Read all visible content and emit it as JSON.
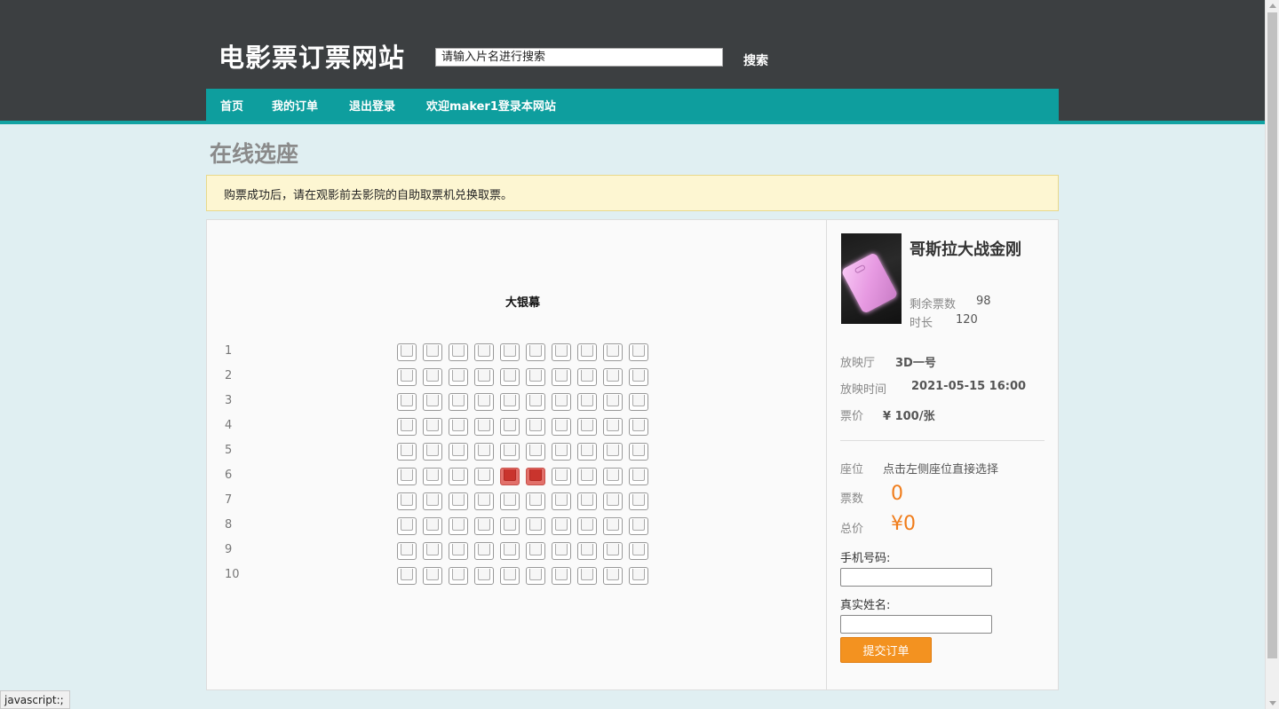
{
  "header": {
    "site_title": "电影票订票网站",
    "search_placeholder": "请输入片名进行搜索",
    "search_button": "搜索",
    "nav": [
      "首页",
      "我的订单",
      "退出登录",
      "欢迎maker1登录本网站"
    ]
  },
  "page": {
    "title": "在线选座",
    "notice": "购票成功后，请在观影前去影院的自助取票机兑换取票。"
  },
  "seating": {
    "screen_label": "大银幕",
    "rows": [
      "1",
      "2",
      "3",
      "4",
      "5",
      "6",
      "7",
      "8",
      "9",
      "10"
    ],
    "seats_per_row": 10,
    "sold": [
      [
        6,
        5
      ],
      [
        6,
        6
      ]
    ]
  },
  "movie": {
    "title": "哥斯拉大战金刚",
    "remaining_label": "剩余票数",
    "remaining_value": "98",
    "duration_label": "时长",
    "duration_value": "120",
    "hall_label": "放映厅",
    "hall_value": "3D一号",
    "time_label": "放映时间",
    "time_value": "2021-05-15 16:00",
    "price_label": "票价",
    "price_value": "¥ 100/张",
    "poster_icon": "phone-poster-icon"
  },
  "order": {
    "seat_label": "座位",
    "seat_value": "点击左侧座位直接选择",
    "count_label": "票数",
    "count_value": "0",
    "total_label": "总价",
    "total_value": "¥0",
    "phone_label": "手机号码:",
    "name_label": "真实姓名:",
    "submit_label": "提交订单"
  },
  "status_bar": "javascript:;",
  "colors": {
    "nav": "#0e9e9e",
    "sold_seat": "#c9342d",
    "accent": "#f07c1a",
    "submit": "#f39220"
  }
}
